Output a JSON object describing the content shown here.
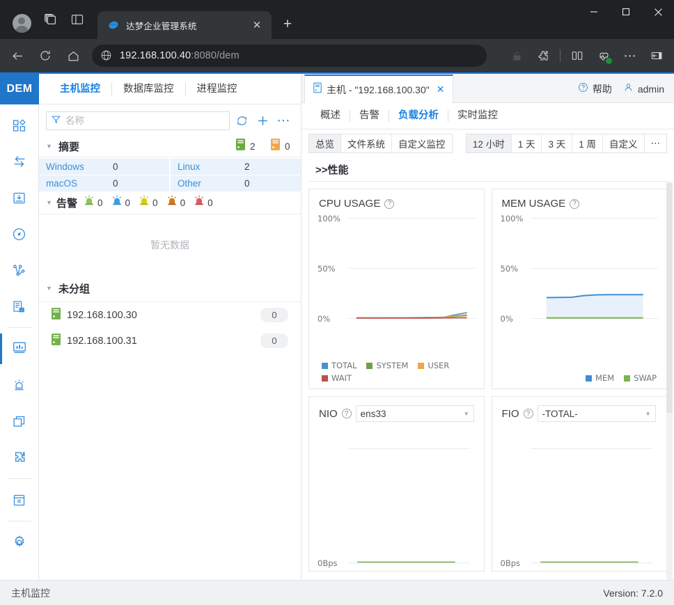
{
  "browser": {
    "profile_icon": "avatar-icon",
    "workspaces_icon": "workspaces-icon",
    "split_icon": "sidebar-toggle-icon",
    "tab": {
      "title": "达梦企业管理系统",
      "favicon": "dameng-logo-icon",
      "close": "✕"
    },
    "new_tab": "+",
    "window": {
      "minimize": "—",
      "maximize": "□",
      "close": "✕"
    },
    "nav": {
      "back": "←",
      "reload": "⟳",
      "home": "⌂"
    },
    "url_main": "192.168.100.40",
    "url_dim": ":8080/dem",
    "toolbar_icons": [
      "lock-icon",
      "extensions-icon",
      "split-screen-icon",
      "browser-essentials-icon",
      "more-icon",
      "collapse-icon"
    ]
  },
  "rail": {
    "logo": "DEM",
    "items": [
      {
        "name": "dashboard-icon"
      },
      {
        "name": "data-transfer-icon"
      },
      {
        "name": "backup-icon"
      },
      {
        "name": "performance-icon"
      },
      {
        "name": "topology-icon"
      },
      {
        "name": "deploy-icon"
      },
      {
        "name": "monitor-chart-icon"
      },
      {
        "name": "alarm-icon"
      },
      {
        "name": "copies-icon"
      },
      {
        "name": "plugin-icon"
      },
      {
        "name": "archive-icon"
      },
      {
        "name": "settings-icon"
      }
    ],
    "active_index": 6
  },
  "topnav": {
    "items": [
      {
        "label": "主机监控",
        "active": true
      },
      {
        "label": "数据库监控",
        "active": false
      },
      {
        "label": "进程监控",
        "active": false
      }
    ]
  },
  "left": {
    "search": {
      "placeholder": "名称",
      "value": "",
      "filter_icon": "filter-icon"
    },
    "tools": [
      {
        "name": "refresh-icon",
        "glyph": "⟳"
      },
      {
        "name": "add-icon",
        "glyph": "+"
      },
      {
        "name": "more-icon",
        "glyph": "⋯"
      }
    ],
    "summary": {
      "title": "摘要",
      "online_count": "2",
      "offline_count": "0",
      "os": [
        {
          "name": "Windows",
          "value": "0"
        },
        {
          "name": "Linux",
          "value": "2"
        },
        {
          "name": "macOS",
          "value": "0"
        },
        {
          "name": "Other",
          "value": "0"
        }
      ]
    },
    "alarm": {
      "title": "告警",
      "levels": [
        {
          "color": "#7ab648",
          "value": "0"
        },
        {
          "color": "#2c8fd4",
          "value": "0"
        },
        {
          "color": "#c2bc00",
          "value": "0"
        },
        {
          "color": "#c4691a",
          "value": "0"
        },
        {
          "color": "#c9434c",
          "value": "0"
        }
      ],
      "empty_text": "暂无数据"
    },
    "group": {
      "title": "未分组",
      "hosts": [
        {
          "name": "192.168.100.30",
          "badge": "0",
          "status_color": "#72b24a"
        },
        {
          "name": "192.168.100.31",
          "badge": "0",
          "status_color": "#72b24a"
        }
      ]
    }
  },
  "right": {
    "tab": {
      "icon": "server-icon",
      "label": "主机 - \"192.168.100.30\"",
      "close": "✕"
    },
    "help": {
      "label": "帮助",
      "icon": "help-icon"
    },
    "user": {
      "label": "admin",
      "icon": "user-icon"
    },
    "subtabs": [
      {
        "label": "概述",
        "active": false
      },
      {
        "label": "告警",
        "active": false
      },
      {
        "label": "负载分析",
        "active": true
      },
      {
        "label": "实时监控",
        "active": false
      }
    ],
    "view_seg": [
      {
        "label": "总览",
        "active": true
      },
      {
        "label": "文件系统",
        "active": false
      },
      {
        "label": "自定义监控",
        "active": false
      }
    ],
    "range_seg": [
      {
        "label": "12 小时",
        "active": true
      },
      {
        "label": "1 天",
        "active": false
      },
      {
        "label": "3 天",
        "active": false
      },
      {
        "label": "1 周",
        "active": false
      },
      {
        "label": "自定义",
        "active": false
      },
      {
        "label": "⋯",
        "active": false
      }
    ],
    "perf_heading": ">>性能"
  },
  "chart_data": [
    {
      "type": "line",
      "title": "CPU USAGE",
      "help_icon": "?",
      "ylabel": "",
      "ylim": [
        0,
        100
      ],
      "yticks": [
        "0%",
        "50%",
        "100%"
      ],
      "grid": true,
      "legend_position": "bottom-left",
      "series": [
        {
          "name": "TOTAL",
          "color": "#4a8fd4",
          "values": [
            0.4,
            0.4,
            0.4,
            0.5,
            0.5,
            0.6,
            0.8,
            1.0,
            3.5,
            5.5
          ]
        },
        {
          "name": "SYSTEM",
          "color": "#6fa14a",
          "values": [
            0.2,
            0.2,
            0.2,
            0.2,
            0.3,
            0.3,
            0.4,
            0.6,
            1.8,
            2.6
          ]
        },
        {
          "name": "USER",
          "color": "#f0a545",
          "values": [
            0.3,
            0.3,
            0.3,
            0.3,
            0.3,
            0.4,
            0.5,
            0.8,
            2.4,
            3.4
          ]
        },
        {
          "name": "WAIT",
          "color": "#c0504d",
          "values": [
            0.1,
            0.1,
            0.1,
            0.1,
            0.1,
            0.1,
            0.1,
            0.2,
            0.3,
            0.4
          ]
        }
      ]
    },
    {
      "type": "area",
      "title": "MEM USAGE",
      "help_icon": "?",
      "ylim": [
        0,
        100
      ],
      "yticks": [
        "0%",
        "50%",
        "100%"
      ],
      "grid": true,
      "legend_position": "bottom-right",
      "series": [
        {
          "name": "MEM",
          "color": "#3d8fd4",
          "fill": "#e8f1fb",
          "values": [
            20.5,
            20.6,
            20.8,
            21.8,
            22.4,
            22.5,
            22.5,
            22.5,
            22.5,
            22.5
          ]
        },
        {
          "name": "SWAP",
          "color": "#7ab648",
          "values": [
            0,
            0,
            0,
            0,
            0,
            0,
            0,
            0,
            0,
            0
          ]
        }
      ]
    },
    {
      "type": "line",
      "title": "NIO",
      "help_icon": "?",
      "selector_value": "ens33",
      "yticks": [
        "0Bps"
      ],
      "grid": true,
      "series": [
        {
          "name": "NIO",
          "color": "#8fbf6a",
          "values": [
            0,
            0,
            0,
            0,
            0,
            0,
            0,
            0
          ]
        }
      ]
    },
    {
      "type": "line",
      "title": "FIO",
      "help_icon": "?",
      "selector_value": "-TOTAL-",
      "yticks": [
        "0Bps"
      ],
      "grid": true,
      "series": [
        {
          "name": "FIO",
          "color": "#8fbf6a",
          "values": [
            0,
            0,
            0,
            0,
            0,
            0,
            0,
            0
          ]
        }
      ]
    }
  ],
  "status": {
    "left": "主机监控",
    "right": "Version: 7.2.0"
  }
}
